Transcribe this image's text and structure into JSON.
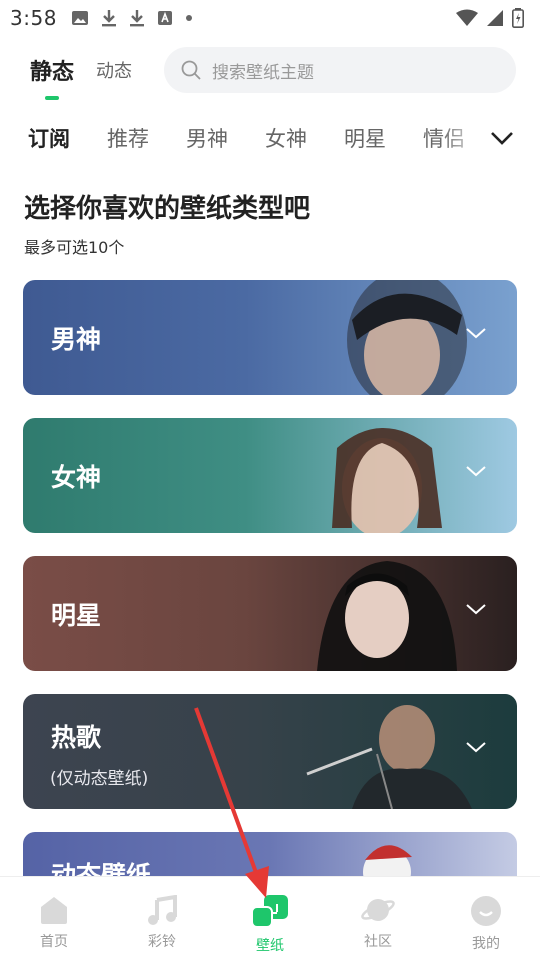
{
  "status_bar": {
    "time": "3:58"
  },
  "header": {
    "tabs": [
      {
        "label": "静态",
        "active": true
      },
      {
        "label": "动态",
        "active": false
      }
    ],
    "search_placeholder": "搜索壁纸主题"
  },
  "categories": [
    "订阅",
    "推荐",
    "男神",
    "女神",
    "明星",
    "情侣"
  ],
  "heading": "选择你喜欢的壁纸类型吧",
  "subheading": "最多可选10个",
  "cards": [
    {
      "title": "男神",
      "subtitle": ""
    },
    {
      "title": "女神",
      "subtitle": ""
    },
    {
      "title": "明星",
      "subtitle": ""
    },
    {
      "title": "热歌",
      "subtitle": "(仅动态壁纸)"
    },
    {
      "title": "动态壁纸",
      "subtitle": ""
    }
  ],
  "bottom_nav": [
    {
      "label": "首页",
      "icon": "home-icon",
      "active": false
    },
    {
      "label": "彩铃",
      "icon": "music-note-icon",
      "active": false
    },
    {
      "label": "壁纸",
      "icon": "wallpaper-icon",
      "active": true
    },
    {
      "label": "社区",
      "icon": "planet-icon",
      "active": false
    },
    {
      "label": "我的",
      "icon": "profile-icon",
      "active": false
    }
  ],
  "colors": {
    "accent": "#1ec66b",
    "annotation_arrow": "#e53935"
  }
}
